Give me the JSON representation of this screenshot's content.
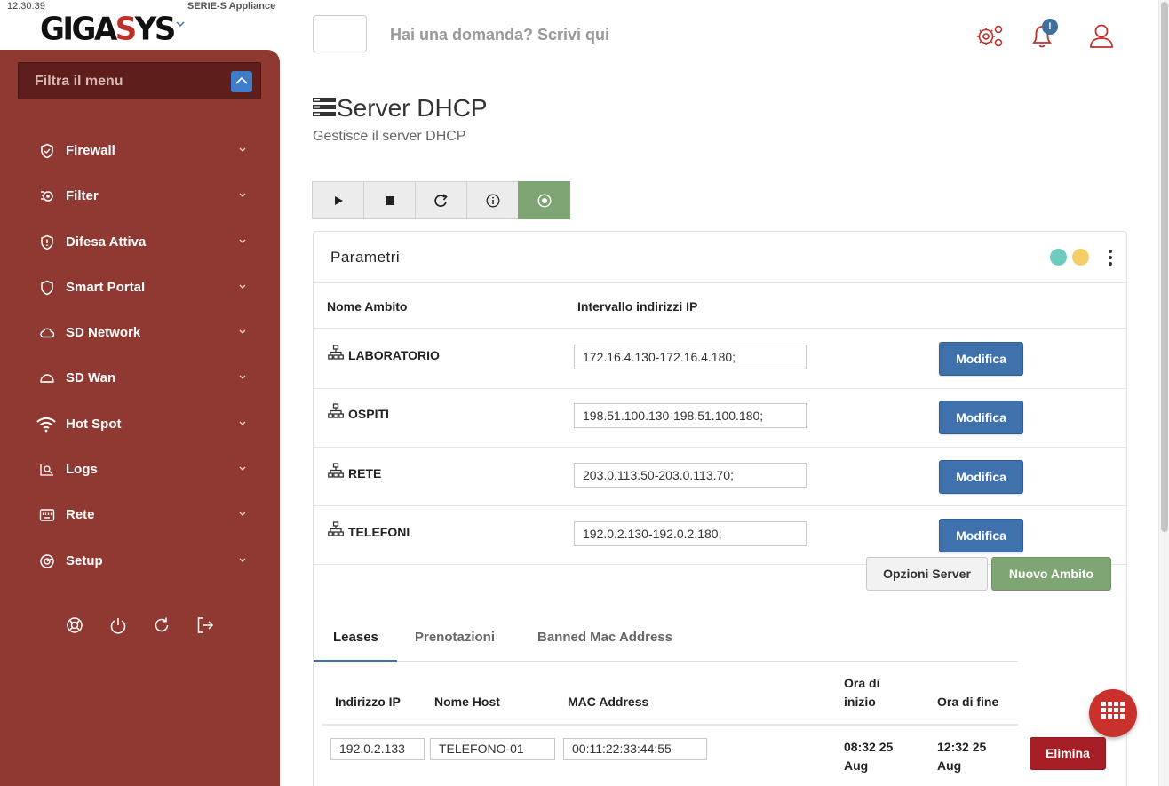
{
  "status": {
    "clock": "12:30:39",
    "appliance": "SERIE-S Appliance"
  },
  "brand": {
    "logo_left": "GIGA",
    "logo_mid": "S",
    "logo_right": "YS"
  },
  "sidebar": {
    "filter_placeholder": "Filtra il menu",
    "items": [
      {
        "label": "Firewall",
        "icon": "shield-check-icon"
      },
      {
        "label": "Filter",
        "icon": "filter-gear-icon"
      },
      {
        "label": "Difesa Attiva",
        "icon": "shield-alert-icon"
      },
      {
        "label": "Smart Portal",
        "icon": "shield-icon"
      },
      {
        "label": "SD Network",
        "icon": "cloud-icon"
      },
      {
        "label": "SD Wan",
        "icon": "cloud-outline-icon"
      },
      {
        "label": "Hot Spot",
        "icon": "wifi-icon"
      },
      {
        "label": "Logs",
        "icon": "log-search-icon"
      },
      {
        "label": "Rete",
        "icon": "network-port-icon"
      },
      {
        "label": "Setup",
        "icon": "setup-gauge-icon"
      }
    ],
    "footer_icons": [
      "lifebuoy-icon",
      "power-icon",
      "refresh-icon",
      "logout-icon"
    ]
  },
  "header": {
    "ask_placeholder": "Hai una domanda? Scrivi qui",
    "notification_badge": "!",
    "icons": [
      "settings-gears-icon",
      "bell-icon",
      "user-icon"
    ]
  },
  "page": {
    "title": "Server DHCP",
    "subtitle": "Gestisce il server DHCP"
  },
  "toolbar": {
    "buttons": [
      "play-icon",
      "stop-icon",
      "redo-icon",
      "info-icon",
      "record-icon"
    ],
    "active": "record-icon"
  },
  "panel": {
    "title": "Parametri",
    "status_dots": [
      "#6fcbc0",
      "#f5ce6a"
    ],
    "columns": {
      "name": "Nome Ambito",
      "range": "Intervallo indirizzi IP"
    },
    "scopes": [
      {
        "name": "LABORATORIO",
        "range": "172.16.4.130-172.16.4.180;",
        "action": "Modifica"
      },
      {
        "name": "OSPITI",
        "range": "198.51.100.130-198.51.100.180;",
        "action": "Modifica"
      },
      {
        "name": "RETE",
        "range": "203.0.113.50-203.0.113.70;",
        "action": "Modifica"
      },
      {
        "name": "TELEFONI",
        "range": "192.0.2.130-192.0.2.180;",
        "action": "Modifica"
      }
    ],
    "server_options_label": "Opzioni Server",
    "new_scope_label": "Nuovo Ambito",
    "tabs": [
      "Leases",
      "Prenotazioni",
      "Banned Mac Address"
    ],
    "active_tab": "Leases",
    "lease_columns": {
      "ip": "Indirizzo IP",
      "host": "Nome Host",
      "mac": "MAC Address",
      "start_1": "Ora di",
      "start_2": "inizio",
      "end": "Ora di fine"
    },
    "leases": [
      {
        "ip": "192.0.2.133",
        "host": "TELEFONO-01",
        "mac": "00:11:22:33:44:55",
        "start_1": "08:32 25",
        "start_2": "Aug",
        "end_1": "12:32 25",
        "end_2": "Aug",
        "action": "Elimina"
      }
    ]
  },
  "colors": {
    "sidebar": "#903832",
    "accent_red": "#c0302b",
    "primary_blue": "#3f72ac",
    "success_green": "#7fa575",
    "danger_red": "#a61f26"
  }
}
